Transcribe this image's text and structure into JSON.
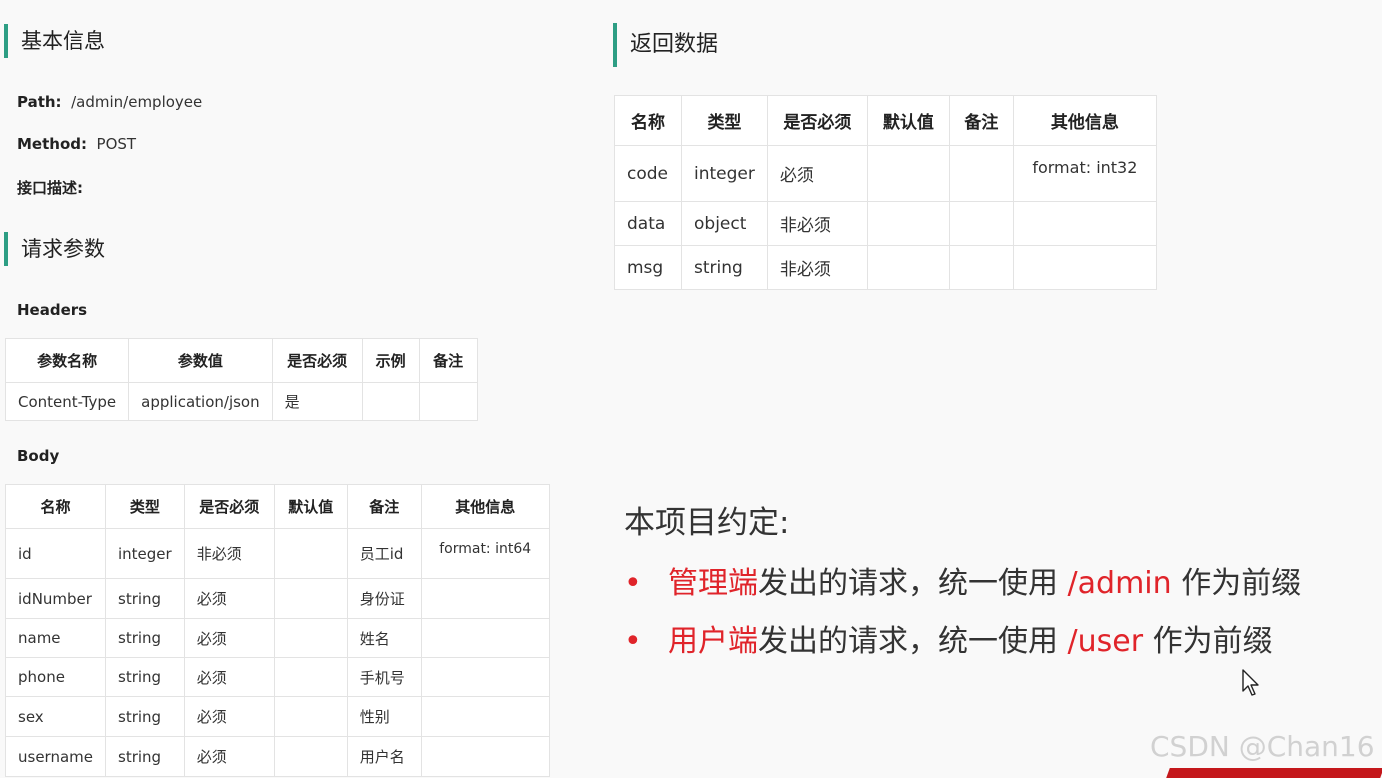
{
  "basic_info": {
    "title": "基本信息",
    "path_label": "Path:",
    "path_value": "/admin/employee",
    "method_label": "Method:",
    "method_value": "POST",
    "desc_label": "接口描述:"
  },
  "request_params": {
    "title": "请求参数",
    "headers_label": "Headers",
    "headers_table": {
      "columns": [
        "参数名称",
        "参数值",
        "是否必须",
        "示例",
        "备注"
      ],
      "rows": [
        [
          "Content-Type",
          "application/json",
          "是",
          "",
          ""
        ]
      ]
    },
    "body_label": "Body",
    "body_table": {
      "columns": [
        "名称",
        "类型",
        "是否必须",
        "默认值",
        "备注",
        "其他信息"
      ],
      "rows": [
        [
          "id",
          "integer",
          "非必须",
          "",
          "员工id",
          "format: int64"
        ],
        [
          "idNumber",
          "string",
          "必须",
          "",
          "身份证",
          ""
        ],
        [
          "name",
          "string",
          "必须",
          "",
          "姓名",
          ""
        ],
        [
          "phone",
          "string",
          "必须",
          "",
          "手机号",
          ""
        ],
        [
          "sex",
          "string",
          "必须",
          "",
          "性别",
          ""
        ],
        [
          "username",
          "string",
          "必须",
          "",
          "用户名",
          ""
        ]
      ]
    }
  },
  "response": {
    "title": "返回数据",
    "table": {
      "columns": [
        "名称",
        "类型",
        "是否必须",
        "默认值",
        "备注",
        "其他信息"
      ],
      "rows": [
        [
          "code",
          "integer",
          "必须",
          "",
          "",
          "format: int32"
        ],
        [
          "data",
          "object",
          "非必须",
          "",
          "",
          ""
        ],
        [
          "msg",
          "string",
          "非必须",
          "",
          "",
          ""
        ]
      ]
    }
  },
  "convention": {
    "title": "本项目约定:",
    "bullet": "•",
    "items": [
      {
        "highlight": "管理端",
        "text1": "发出的请求，统一使用 ",
        "path": "/admin",
        "text2": " 作为前缀"
      },
      {
        "highlight": "用户端",
        "text1": "发出的请求，统一使用 ",
        "path": "/user",
        "text2": " 作为前缀"
      }
    ]
  },
  "watermark": "CSDN @Chan16",
  "colors": {
    "accent": "#2e9e84",
    "highlight": "#e0242a"
  },
  "icons": {
    "cursor": "mouse-cursor-icon"
  }
}
